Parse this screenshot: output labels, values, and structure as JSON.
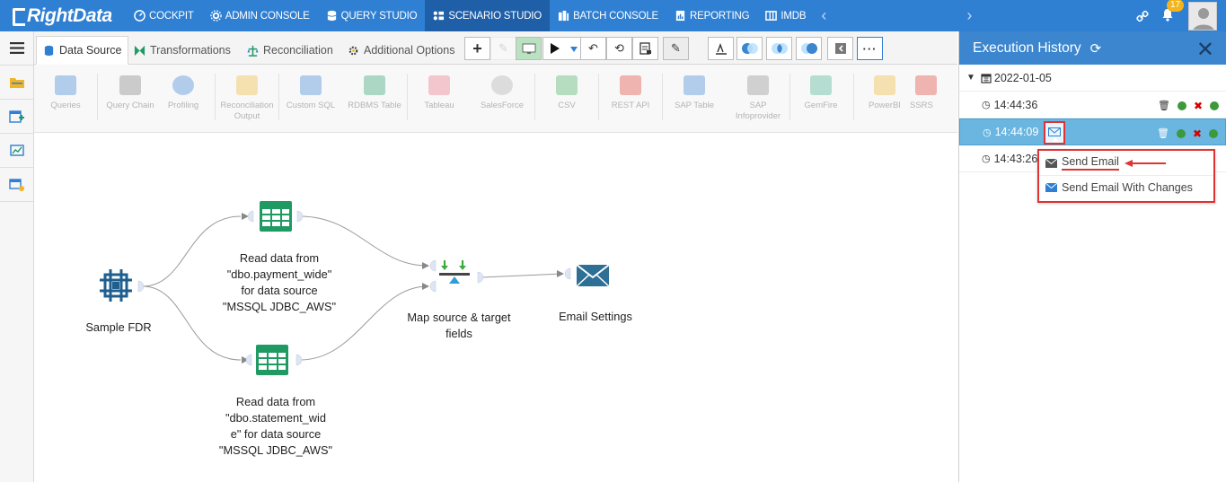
{
  "brand": {
    "logo_text": "RightData"
  },
  "topnav": {
    "items": [
      {
        "label": "COCKPIT",
        "icon": "gauge-icon"
      },
      {
        "label": "ADMIN CONSOLE",
        "icon": "gear-icon"
      },
      {
        "label": "QUERY STUDIO",
        "icon": "database-icon"
      },
      {
        "label": "SCENARIO STUDIO",
        "icon": "scenario-icon",
        "active": true
      },
      {
        "label": "BATCH CONSOLE",
        "icon": "batch-icon"
      },
      {
        "label": "REPORTING",
        "icon": "report-icon"
      },
      {
        "label": "IMDB",
        "icon": "columns-icon"
      }
    ],
    "notification_count": "17"
  },
  "tabs": {
    "data_source": "Data Source",
    "transformations": "Transformations",
    "reconciliation": "Reconciliation",
    "additional_options": "Additional Options"
  },
  "ribbon": {
    "items": [
      "Queries",
      "Query Chain",
      "Profiling",
      "Reconciliation Output",
      "Custom SQL",
      "RDBMS Table",
      "Tableau",
      "SalesForce",
      "CSV",
      "REST API",
      "SAP Table",
      "SAP Infoprovider",
      "GemFire",
      "PowerBI",
      "SSRS"
    ]
  },
  "canvas": {
    "nodes": {
      "source": "Sample FDR",
      "read1": [
        "Read data from",
        "\"dbo.payment_wide\"",
        "for data source",
        "\"MSSQL JDBC_AWS\""
      ],
      "read2": [
        "Read data from",
        "\"dbo.statement_wid",
        "e\" for data source",
        "\"MSSQL JDBC_AWS\""
      ],
      "map": [
        "Map source & target",
        "fields"
      ],
      "email": "Email Settings"
    }
  },
  "panel": {
    "title": "Execution History",
    "date": "2022-01-05",
    "rows": [
      {
        "time": "14:44:36"
      },
      {
        "time": "14:44:09",
        "selected": true
      },
      {
        "time": "14:43:26"
      }
    ],
    "menu": {
      "send_email": "Send Email",
      "send_email_changes": "Send Email With Changes"
    }
  },
  "colors": {
    "nav_bg": "#2f7fd3",
    "nav_active": "#1f5fa8",
    "panel_head": "#3b86cf",
    "selected_row": "#6ab6e0",
    "node_green": "#1f9a63",
    "highlight_red": "#e03333"
  }
}
